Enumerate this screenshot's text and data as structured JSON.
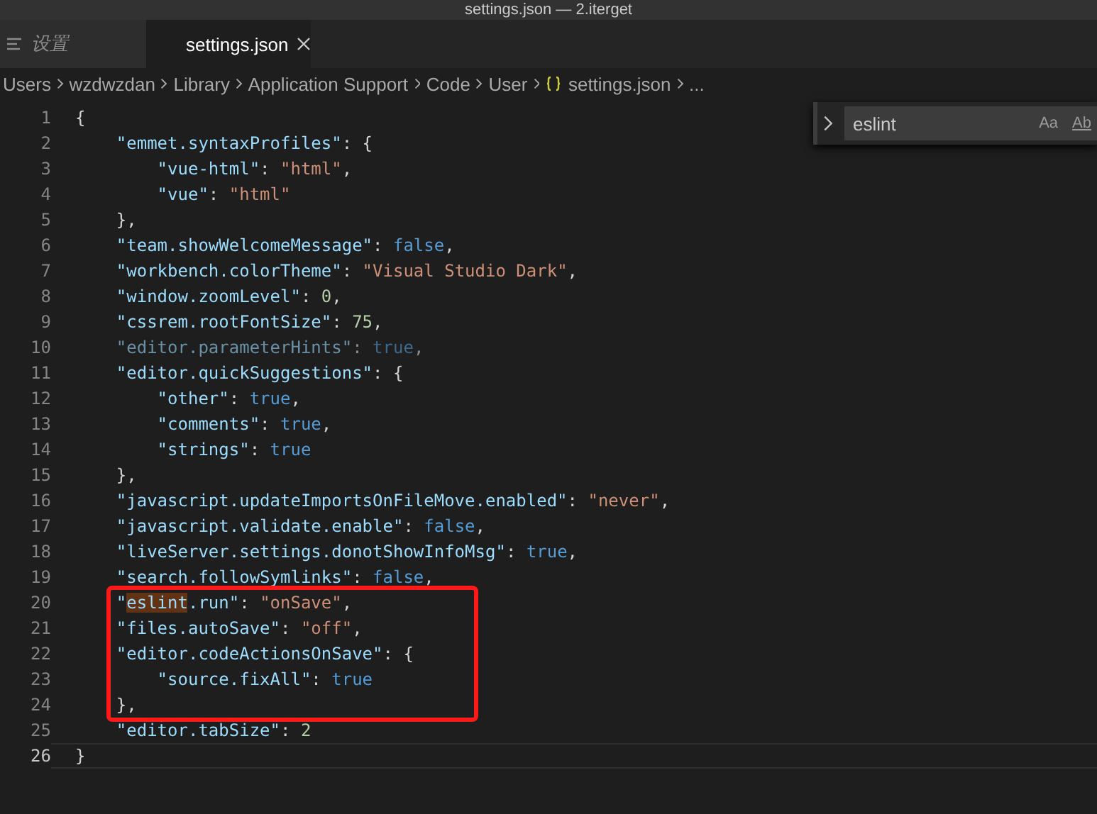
{
  "window": {
    "title": "settings.json — 2.iterget"
  },
  "tabs": [
    {
      "label": "设置",
      "kind": "ui",
      "selected": false
    },
    {
      "label": "settings.json",
      "kind": "file",
      "selected": true
    }
  ],
  "breadcrumb": [
    {
      "label": "Users",
      "kind": "folder"
    },
    {
      "label": "wzdwzdan",
      "kind": "folder"
    },
    {
      "label": "Library",
      "kind": "folder"
    },
    {
      "label": "Application Support",
      "kind": "folder"
    },
    {
      "label": "Code",
      "kind": "folder"
    },
    {
      "label": "User",
      "kind": "folder"
    },
    {
      "label": "settings.json",
      "kind": "file"
    },
    {
      "label": "...",
      "kind": "more"
    }
  ],
  "find_widget": {
    "expanded": false,
    "value": "eslint",
    "options": [
      "Aa",
      "Ab"
    ]
  },
  "editor": {
    "lines": [
      {
        "number": "1",
        "current": false,
        "dimmed": false,
        "framed": false,
        "tokens": [
          {
            "kind": "p",
            "text": "{"
          }
        ]
      },
      {
        "number": "2",
        "current": false,
        "dimmed": false,
        "framed": false,
        "tokens": [
          {
            "kind": "key",
            "text": "    \"emmet.syntaxProfiles\""
          },
          {
            "kind": "p",
            "text": ": {"
          }
        ]
      },
      {
        "number": "3",
        "current": false,
        "dimmed": false,
        "framed": false,
        "tokens": [
          {
            "kind": "key",
            "text": "        \"vue-html\""
          },
          {
            "kind": "p",
            "text": ": "
          },
          {
            "kind": "str",
            "text": "\"html\""
          },
          {
            "kind": "p",
            "text": ","
          }
        ]
      },
      {
        "number": "4",
        "current": false,
        "dimmed": false,
        "framed": false,
        "tokens": [
          {
            "kind": "key",
            "text": "        \"vue\""
          },
          {
            "kind": "p",
            "text": ": "
          },
          {
            "kind": "str",
            "text": "\"html\""
          }
        ]
      },
      {
        "number": "5",
        "current": false,
        "dimmed": false,
        "framed": false,
        "tokens": [
          {
            "kind": "p",
            "text": "    },"
          }
        ]
      },
      {
        "number": "6",
        "current": false,
        "dimmed": false,
        "framed": false,
        "tokens": [
          {
            "kind": "key",
            "text": "    \"team.showWelcomeMessage\""
          },
          {
            "kind": "p",
            "text": ": "
          },
          {
            "kind": "kw",
            "text": "false"
          },
          {
            "kind": "p",
            "text": ","
          }
        ]
      },
      {
        "number": "7",
        "current": false,
        "dimmed": false,
        "framed": false,
        "tokens": [
          {
            "kind": "key",
            "text": "    \"workbench.colorTheme\""
          },
          {
            "kind": "p",
            "text": ": "
          },
          {
            "kind": "str",
            "text": "\"Visual Studio Dark\""
          },
          {
            "kind": "p",
            "text": ","
          }
        ]
      },
      {
        "number": "8",
        "current": false,
        "dimmed": false,
        "framed": false,
        "tokens": [
          {
            "kind": "key",
            "text": "    \"window.zoomLevel\""
          },
          {
            "kind": "p",
            "text": ": "
          },
          {
            "kind": "num",
            "text": "0"
          },
          {
            "kind": "p",
            "text": ","
          }
        ]
      },
      {
        "number": "9",
        "current": false,
        "dimmed": false,
        "framed": false,
        "tokens": [
          {
            "kind": "key",
            "text": "    \"cssrem.rootFontSize\""
          },
          {
            "kind": "p",
            "text": ": "
          },
          {
            "kind": "num",
            "text": "75"
          },
          {
            "kind": "p",
            "text": ","
          }
        ]
      },
      {
        "number": "10",
        "current": false,
        "dimmed": true,
        "framed": false,
        "tokens": [
          {
            "kind": "key",
            "text": "    \"editor.parameterHints\""
          },
          {
            "kind": "p",
            "text": ": "
          },
          {
            "kind": "kw",
            "text": "true"
          },
          {
            "kind": "p",
            "text": ","
          }
        ]
      },
      {
        "number": "11",
        "current": false,
        "dimmed": false,
        "framed": false,
        "tokens": [
          {
            "kind": "key",
            "text": "    \"editor.quickSuggestions\""
          },
          {
            "kind": "p",
            "text": ": {"
          }
        ]
      },
      {
        "number": "12",
        "current": false,
        "dimmed": false,
        "framed": false,
        "tokens": [
          {
            "kind": "key",
            "text": "        \"other\""
          },
          {
            "kind": "p",
            "text": ": "
          },
          {
            "kind": "kw",
            "text": "true"
          },
          {
            "kind": "p",
            "text": ","
          }
        ]
      },
      {
        "number": "13",
        "current": false,
        "dimmed": false,
        "framed": false,
        "tokens": [
          {
            "kind": "key",
            "text": "        \"comments\""
          },
          {
            "kind": "p",
            "text": ": "
          },
          {
            "kind": "kw",
            "text": "true"
          },
          {
            "kind": "p",
            "text": ","
          }
        ]
      },
      {
        "number": "14",
        "current": false,
        "dimmed": false,
        "framed": false,
        "tokens": [
          {
            "kind": "key",
            "text": "        \"strings\""
          },
          {
            "kind": "p",
            "text": ": "
          },
          {
            "kind": "kw",
            "text": "true"
          }
        ]
      },
      {
        "number": "15",
        "current": false,
        "dimmed": false,
        "framed": false,
        "tokens": [
          {
            "kind": "p",
            "text": "    },"
          }
        ]
      },
      {
        "number": "16",
        "current": false,
        "dimmed": false,
        "framed": false,
        "tokens": [
          {
            "kind": "key",
            "text": "    \"javascript.updateImportsOnFileMove.enabled\""
          },
          {
            "kind": "p",
            "text": ": "
          },
          {
            "kind": "str",
            "text": "\"never\""
          },
          {
            "kind": "p",
            "text": ","
          }
        ]
      },
      {
        "number": "17",
        "current": false,
        "dimmed": false,
        "framed": false,
        "tokens": [
          {
            "kind": "key",
            "text": "    \"javascript.validate.enable\""
          },
          {
            "kind": "p",
            "text": ": "
          },
          {
            "kind": "kw",
            "text": "false"
          },
          {
            "kind": "p",
            "text": ","
          }
        ]
      },
      {
        "number": "18",
        "current": false,
        "dimmed": false,
        "framed": false,
        "tokens": [
          {
            "kind": "key",
            "text": "    \"liveServer.settings.donotShowInfoMsg\""
          },
          {
            "kind": "p",
            "text": ": "
          },
          {
            "kind": "kw",
            "text": "true"
          },
          {
            "kind": "p",
            "text": ","
          }
        ]
      },
      {
        "number": "19",
        "current": false,
        "dimmed": false,
        "framed": false,
        "tokens": [
          {
            "kind": "key",
            "text": "    \"search.followSymlinks\""
          },
          {
            "kind": "p",
            "text": ": "
          },
          {
            "kind": "kw",
            "text": "false"
          },
          {
            "kind": "p",
            "text": ","
          }
        ]
      },
      {
        "number": "20",
        "current": false,
        "dimmed": false,
        "framed": true,
        "tokens": [
          {
            "kind": "key",
            "text": "    \""
          },
          {
            "kind": "match",
            "text": "eslint"
          },
          {
            "kind": "key",
            "text": ".run\""
          },
          {
            "kind": "p",
            "text": ": "
          },
          {
            "kind": "str",
            "text": "\"onSave\""
          },
          {
            "kind": "p",
            "text": ","
          }
        ]
      },
      {
        "number": "21",
        "current": false,
        "dimmed": false,
        "framed": true,
        "tokens": [
          {
            "kind": "key",
            "text": "    \"files.autoSave\""
          },
          {
            "kind": "p",
            "text": ": "
          },
          {
            "kind": "str",
            "text": "\"off\""
          },
          {
            "kind": "p",
            "text": ","
          }
        ]
      },
      {
        "number": "22",
        "current": false,
        "dimmed": false,
        "framed": true,
        "tokens": [
          {
            "kind": "key",
            "text": "    \"editor.codeActionsOnSave\""
          },
          {
            "kind": "p",
            "text": ": {"
          }
        ]
      },
      {
        "number": "23",
        "current": false,
        "dimmed": false,
        "framed": true,
        "tokens": [
          {
            "kind": "key",
            "text": "        \"source.fixAll\""
          },
          {
            "kind": "p",
            "text": ": "
          },
          {
            "kind": "kw",
            "text": "true"
          }
        ]
      },
      {
        "number": "24",
        "current": false,
        "dimmed": false,
        "framed": true,
        "tokens": [
          {
            "kind": "p",
            "text": "    },"
          }
        ]
      },
      {
        "number": "25",
        "current": false,
        "dimmed": false,
        "framed": false,
        "tokens": [
          {
            "kind": "key",
            "text": "    \"editor.tabSize\""
          },
          {
            "kind": "p",
            "text": ": "
          },
          {
            "kind": "num",
            "text": "2"
          }
        ]
      },
      {
        "number": "26",
        "current": true,
        "dimmed": false,
        "framed": false,
        "tokens": [
          {
            "kind": "p",
            "text": "}"
          }
        ]
      }
    ]
  }
}
